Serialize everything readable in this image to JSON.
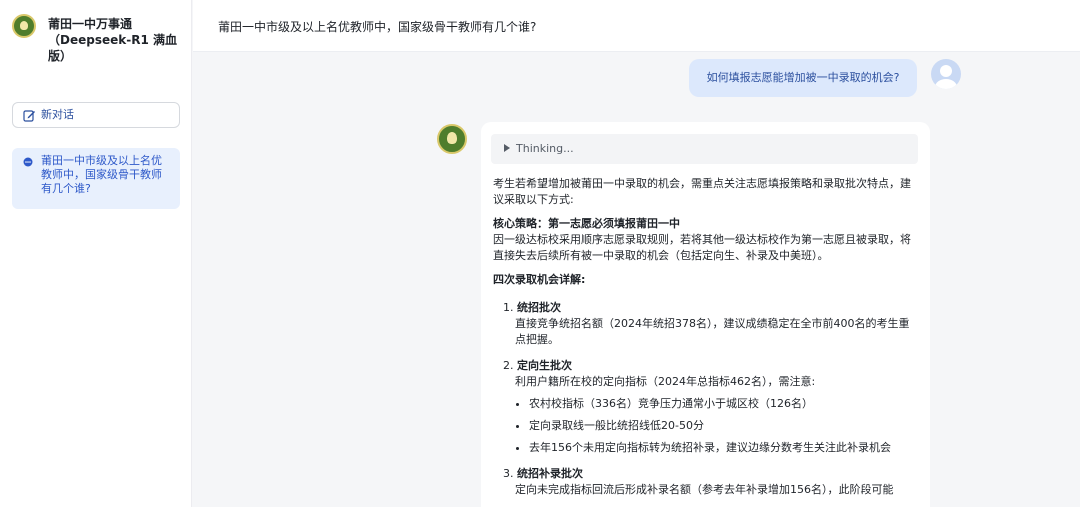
{
  "sidebar": {
    "app_title": "莆田一中万事通（Deepseek-R1 满血版）",
    "new_chat_label": "新对话",
    "history": [
      "莆田一中市级及以上名优教师中，国家级骨干教师有几个谁?"
    ]
  },
  "topbar": {
    "title": "莆田一中市级及以上名优教师中，国家级骨干教师有几个谁?"
  },
  "conversation": {
    "user_message": "如何填报志愿能增加被一中录取的机会?",
    "thinking_label": "Thinking...",
    "answer": {
      "intro": "考生若希望增加被莆田一中录取的机会，需重点关注志愿填报策略和录取批次特点，建议采取以下方式:",
      "core_title": "核心策略：第一志愿必须填报莆田一中",
      "core_text": "因一级达标校采用顺序志愿录取规则，若将其他一级达标校作为第一志愿且被录取，将直接失去后续所有被一中录取的机会（包括定向生、补录及中美班）。",
      "section_title": "四次录取机会详解:",
      "items": [
        {
          "num": "1.",
          "title": "统招批次",
          "desc": "直接竞争统招名额（2024年统招378名），建议成绩稳定在全市前400名的考生重点把握。"
        },
        {
          "num": "2.",
          "title": "定向生批次",
          "desc": "利用户籍所在校的定向指标（2024年总指标462名），需注意:",
          "bullets": [
            "农村校指标（336名）竞争压力通常小于城区校（126名）",
            "定向录取线一般比统招线低20-50分",
            "去年156个未用定向指标转为统招补录，建议边缘分数考生关注此补录机会"
          ]
        },
        {
          "num": "3.",
          "title": "统招补录批次",
          "desc": "定向未完成指标回流后形成补录名额（参考去年补录增加156名），此阶段可能"
        }
      ]
    }
  }
}
